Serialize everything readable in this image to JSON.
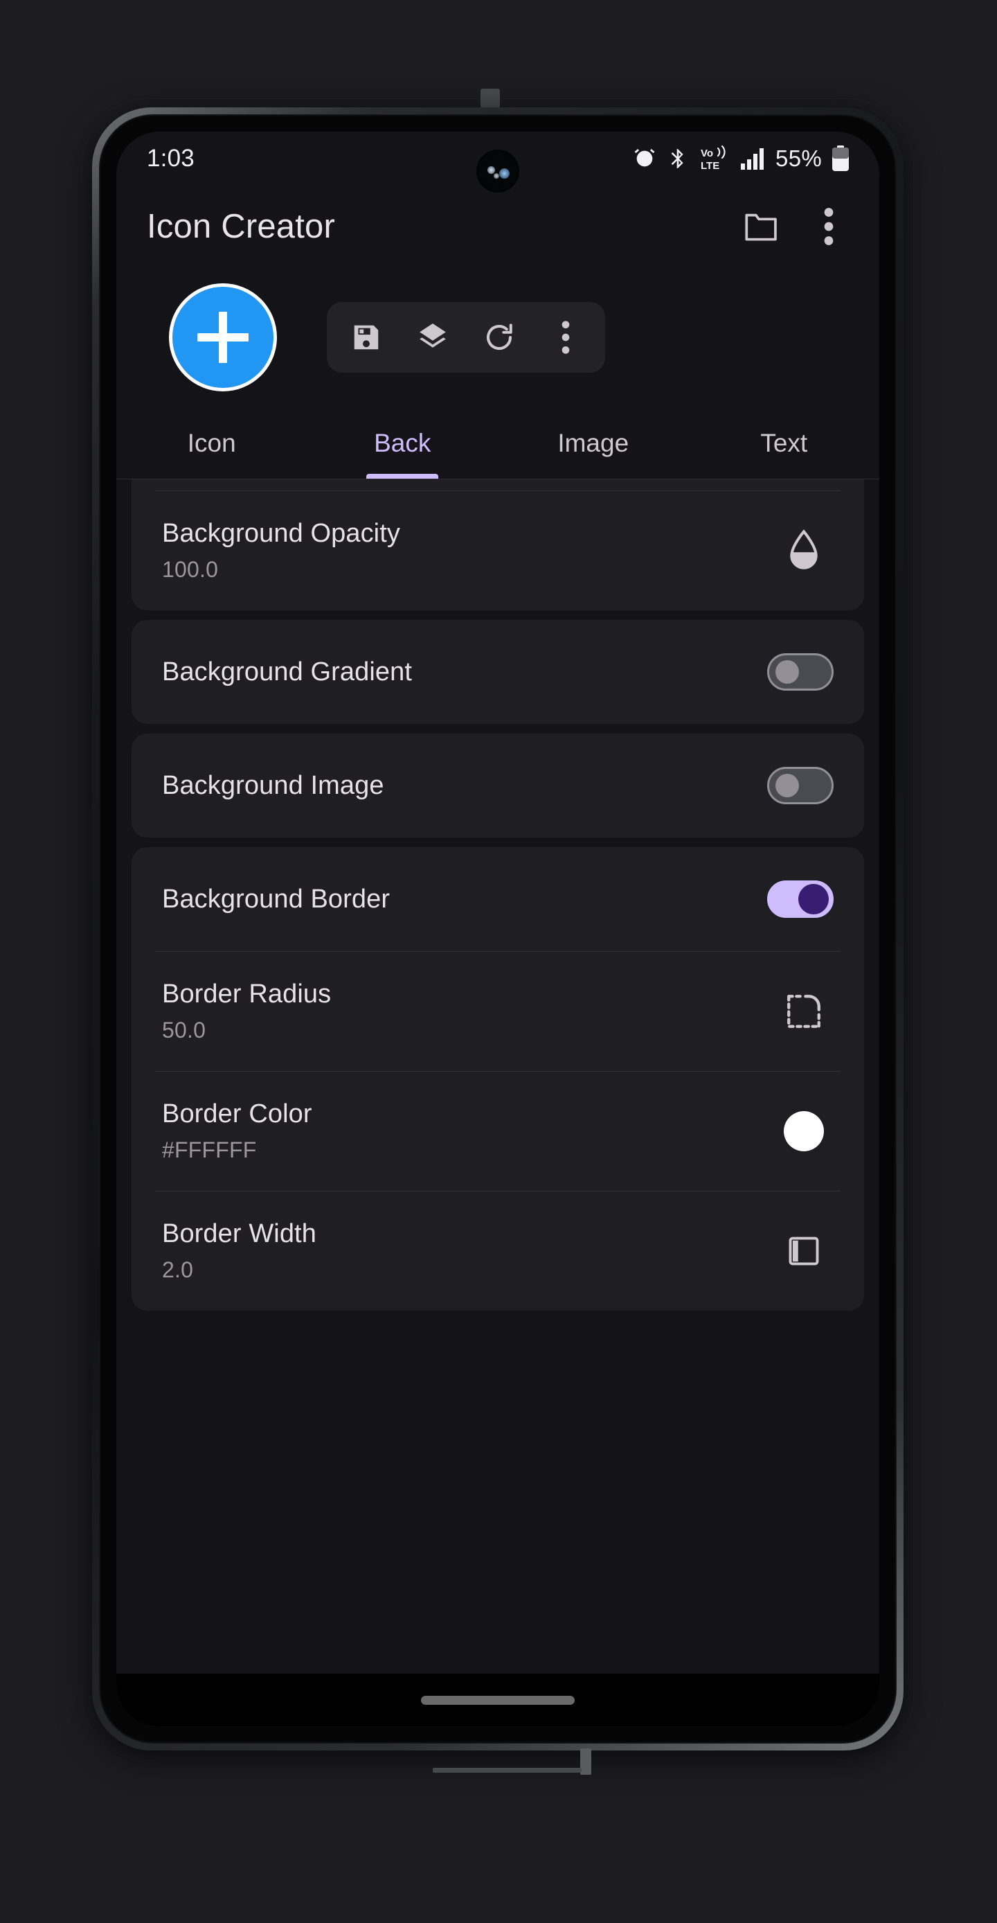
{
  "status_bar": {
    "time": "1:03",
    "battery_percent": "55%",
    "icons": [
      "alarm-icon",
      "bluetooth-icon",
      "volte-icon",
      "signal-bars-icon",
      "battery-icon"
    ],
    "volte_top": "Vo))",
    "volte_bottom": "LTE"
  },
  "app_bar": {
    "title": "Icon Creator",
    "actions": [
      "folder-icon",
      "overflow-menu-icon"
    ]
  },
  "preview": {
    "fab_icon": "plus-icon",
    "fab_color": "#2196F3",
    "fab_border_color": "#FFFFFF",
    "tools": [
      "save-icon",
      "layers-icon",
      "refresh-icon",
      "overflow-menu-icon"
    ]
  },
  "tabs": {
    "items": [
      {
        "label": "Icon",
        "active": false
      },
      {
        "label": "Back",
        "active": true
      },
      {
        "label": "Image",
        "active": false
      },
      {
        "label": "Text",
        "active": false
      }
    ],
    "active_color": "#CFBCFF"
  },
  "settings": {
    "clipped_top_value": "#2196F3",
    "background_opacity": {
      "title": "Background Opacity",
      "value": "100.0",
      "icon": "opacity-drop-icon"
    },
    "background_gradient": {
      "title": "Background Gradient",
      "toggle": "off"
    },
    "background_image": {
      "title": "Background Image",
      "toggle": "off"
    },
    "background_border": {
      "title": "Background Border",
      "toggle": "on"
    },
    "border_radius": {
      "title": "Border Radius",
      "value": "50.0",
      "icon": "rounded-corner-icon"
    },
    "border_color": {
      "title": "Border Color",
      "value": "#FFFFFF",
      "icon": "color-swatch-icon",
      "swatch_color": "#FFFFFF"
    },
    "border_width": {
      "title": "Border Width",
      "value": "2.0",
      "icon": "border-width-icon"
    }
  }
}
